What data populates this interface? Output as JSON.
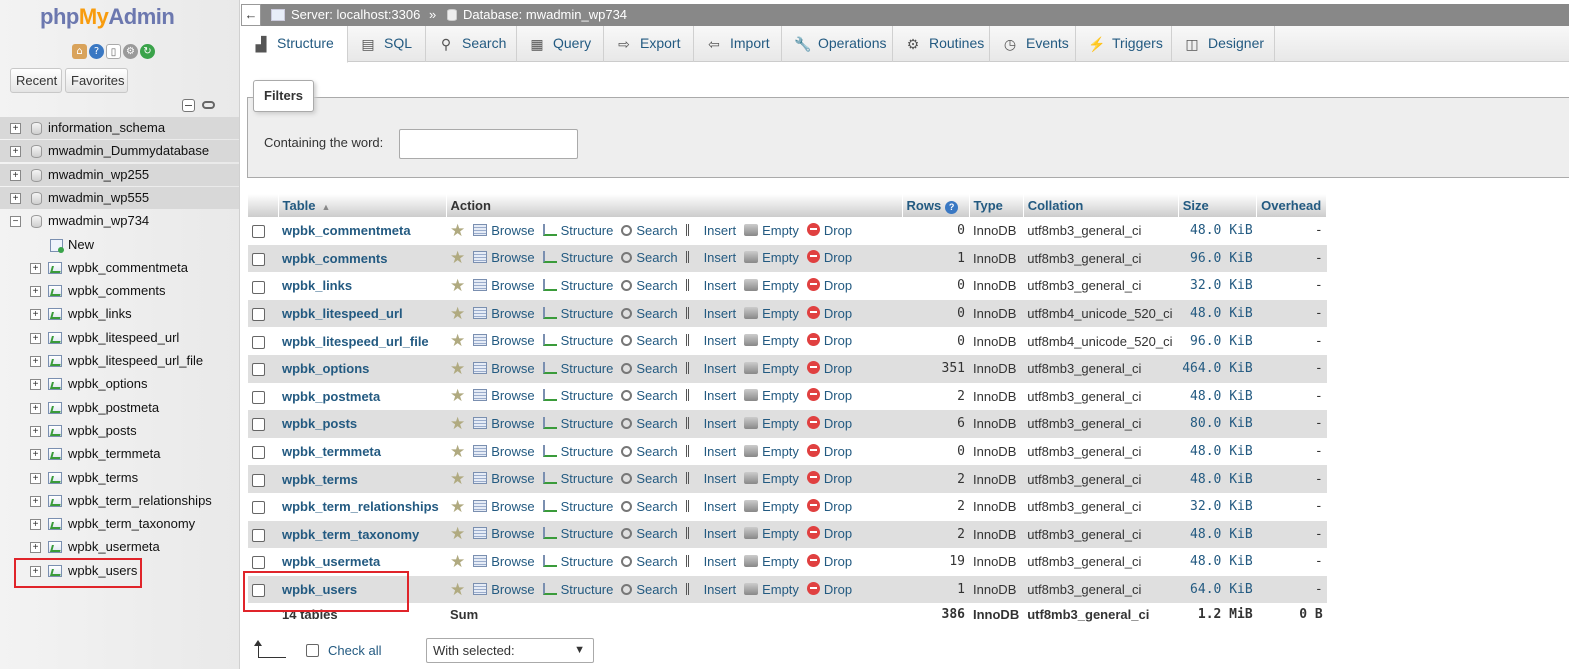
{
  "nav": {
    "logo": {
      "part1": "php",
      "part2": "My",
      "part3": "Admin"
    },
    "icons": [
      "home-icon",
      "help-icon",
      "docs-icon",
      "settings-icon",
      "reload-icon"
    ],
    "recent_label": "Recent",
    "favorites_label": "Favorites",
    "databases": [
      {
        "name": "information_schema",
        "expanded": false
      },
      {
        "name": "mwadmin_Dummydatabase",
        "expanded": false
      },
      {
        "name": "mwadmin_wp255",
        "expanded": false
      },
      {
        "name": "mwadmin_wp555",
        "expanded": false
      },
      {
        "name": "mwadmin_wp734",
        "expanded": true
      }
    ],
    "new_label": "New",
    "tables": [
      "wpbk_commentmeta",
      "wpbk_comments",
      "wpbk_links",
      "wpbk_litespeed_url",
      "wpbk_litespeed_url_file",
      "wpbk_options",
      "wpbk_postmeta",
      "wpbk_posts",
      "wpbk_termmeta",
      "wpbk_terms",
      "wpbk_term_relationships",
      "wpbk_term_taxonomy",
      "wpbk_usermeta",
      "wpbk_users"
    ]
  },
  "breadcrumb": {
    "back_arrow": "←",
    "server": "Server: localhost:3306",
    "separator": "»",
    "database": "Database: mwadmin_wp734"
  },
  "tabs": [
    {
      "label": "Structure",
      "icon": "structure-icon",
      "active": true
    },
    {
      "label": "SQL",
      "icon": "sql-icon"
    },
    {
      "label": "Search",
      "icon": "search-icon"
    },
    {
      "label": "Query",
      "icon": "query-icon"
    },
    {
      "label": "Export",
      "icon": "export-icon"
    },
    {
      "label": "Import",
      "icon": "import-icon"
    },
    {
      "label": "Operations",
      "icon": "wrench-icon"
    },
    {
      "label": "Routines",
      "icon": "routines-icon"
    },
    {
      "label": "Events",
      "icon": "clock-icon"
    },
    {
      "label": "Triggers",
      "icon": "triggers-icon"
    },
    {
      "label": "Designer",
      "icon": "designer-icon"
    }
  ],
  "filters": {
    "legend": "Filters",
    "label": "Containing the word:",
    "value": ""
  },
  "table": {
    "headers": {
      "table": "Table",
      "action": "Action",
      "rows": "Rows",
      "type": "Type",
      "collation": "Collation",
      "size": "Size",
      "overhead": "Overhead"
    },
    "actions": [
      "Browse",
      "Structure",
      "Search",
      "Insert",
      "Empty",
      "Drop"
    ],
    "rows": [
      {
        "name": "wpbk_commentmeta",
        "rows": "0",
        "type": "InnoDB",
        "collation": "utf8mb3_general_ci",
        "size": "48.0",
        "unit": "KiB",
        "overhead": "-"
      },
      {
        "name": "wpbk_comments",
        "rows": "1",
        "type": "InnoDB",
        "collation": "utf8mb3_general_ci",
        "size": "96.0",
        "unit": "KiB",
        "overhead": "-"
      },
      {
        "name": "wpbk_links",
        "rows": "0",
        "type": "InnoDB",
        "collation": "utf8mb3_general_ci",
        "size": "32.0",
        "unit": "KiB",
        "overhead": "-"
      },
      {
        "name": "wpbk_litespeed_url",
        "rows": "0",
        "type": "InnoDB",
        "collation": "utf8mb4_unicode_520_ci",
        "size": "48.0",
        "unit": "KiB",
        "overhead": "-"
      },
      {
        "name": "wpbk_litespeed_url_file",
        "rows": "0",
        "type": "InnoDB",
        "collation": "utf8mb4_unicode_520_ci",
        "size": "96.0",
        "unit": "KiB",
        "overhead": "-"
      },
      {
        "name": "wpbk_options",
        "rows": "351",
        "type": "InnoDB",
        "collation": "utf8mb3_general_ci",
        "size": "464.0",
        "unit": "KiB",
        "overhead": "-"
      },
      {
        "name": "wpbk_postmeta",
        "rows": "2",
        "type": "InnoDB",
        "collation": "utf8mb3_general_ci",
        "size": "48.0",
        "unit": "KiB",
        "overhead": "-"
      },
      {
        "name": "wpbk_posts",
        "rows": "6",
        "type": "InnoDB",
        "collation": "utf8mb3_general_ci",
        "size": "80.0",
        "unit": "KiB",
        "overhead": "-"
      },
      {
        "name": "wpbk_termmeta",
        "rows": "0",
        "type": "InnoDB",
        "collation": "utf8mb3_general_ci",
        "size": "48.0",
        "unit": "KiB",
        "overhead": "-"
      },
      {
        "name": "wpbk_terms",
        "rows": "2",
        "type": "InnoDB",
        "collation": "utf8mb3_general_ci",
        "size": "48.0",
        "unit": "KiB",
        "overhead": "-"
      },
      {
        "name": "wpbk_term_relationships",
        "rows": "2",
        "type": "InnoDB",
        "collation": "utf8mb3_general_ci",
        "size": "32.0",
        "unit": "KiB",
        "overhead": "-"
      },
      {
        "name": "wpbk_term_taxonomy",
        "rows": "2",
        "type": "InnoDB",
        "collation": "utf8mb3_general_ci",
        "size": "48.0",
        "unit": "KiB",
        "overhead": "-"
      },
      {
        "name": "wpbk_usermeta",
        "rows": "19",
        "type": "InnoDB",
        "collation": "utf8mb3_general_ci",
        "size": "48.0",
        "unit": "KiB",
        "overhead": "-"
      },
      {
        "name": "wpbk_users",
        "rows": "1",
        "type": "InnoDB",
        "collation": "utf8mb3_general_ci",
        "size": "64.0",
        "unit": "KiB",
        "overhead": "-"
      }
    ],
    "footer": {
      "count": "14 tables",
      "sum": "Sum",
      "rows": "386",
      "type": "InnoDB",
      "collation": "utf8mb3_general_ci",
      "size": "1.2 MiB",
      "overhead": "0 B"
    }
  },
  "bottom": {
    "check_all": "Check all",
    "with_selected": "With selected:"
  },
  "colors": {
    "link": "#235a81",
    "highlight": "#e0242a"
  }
}
